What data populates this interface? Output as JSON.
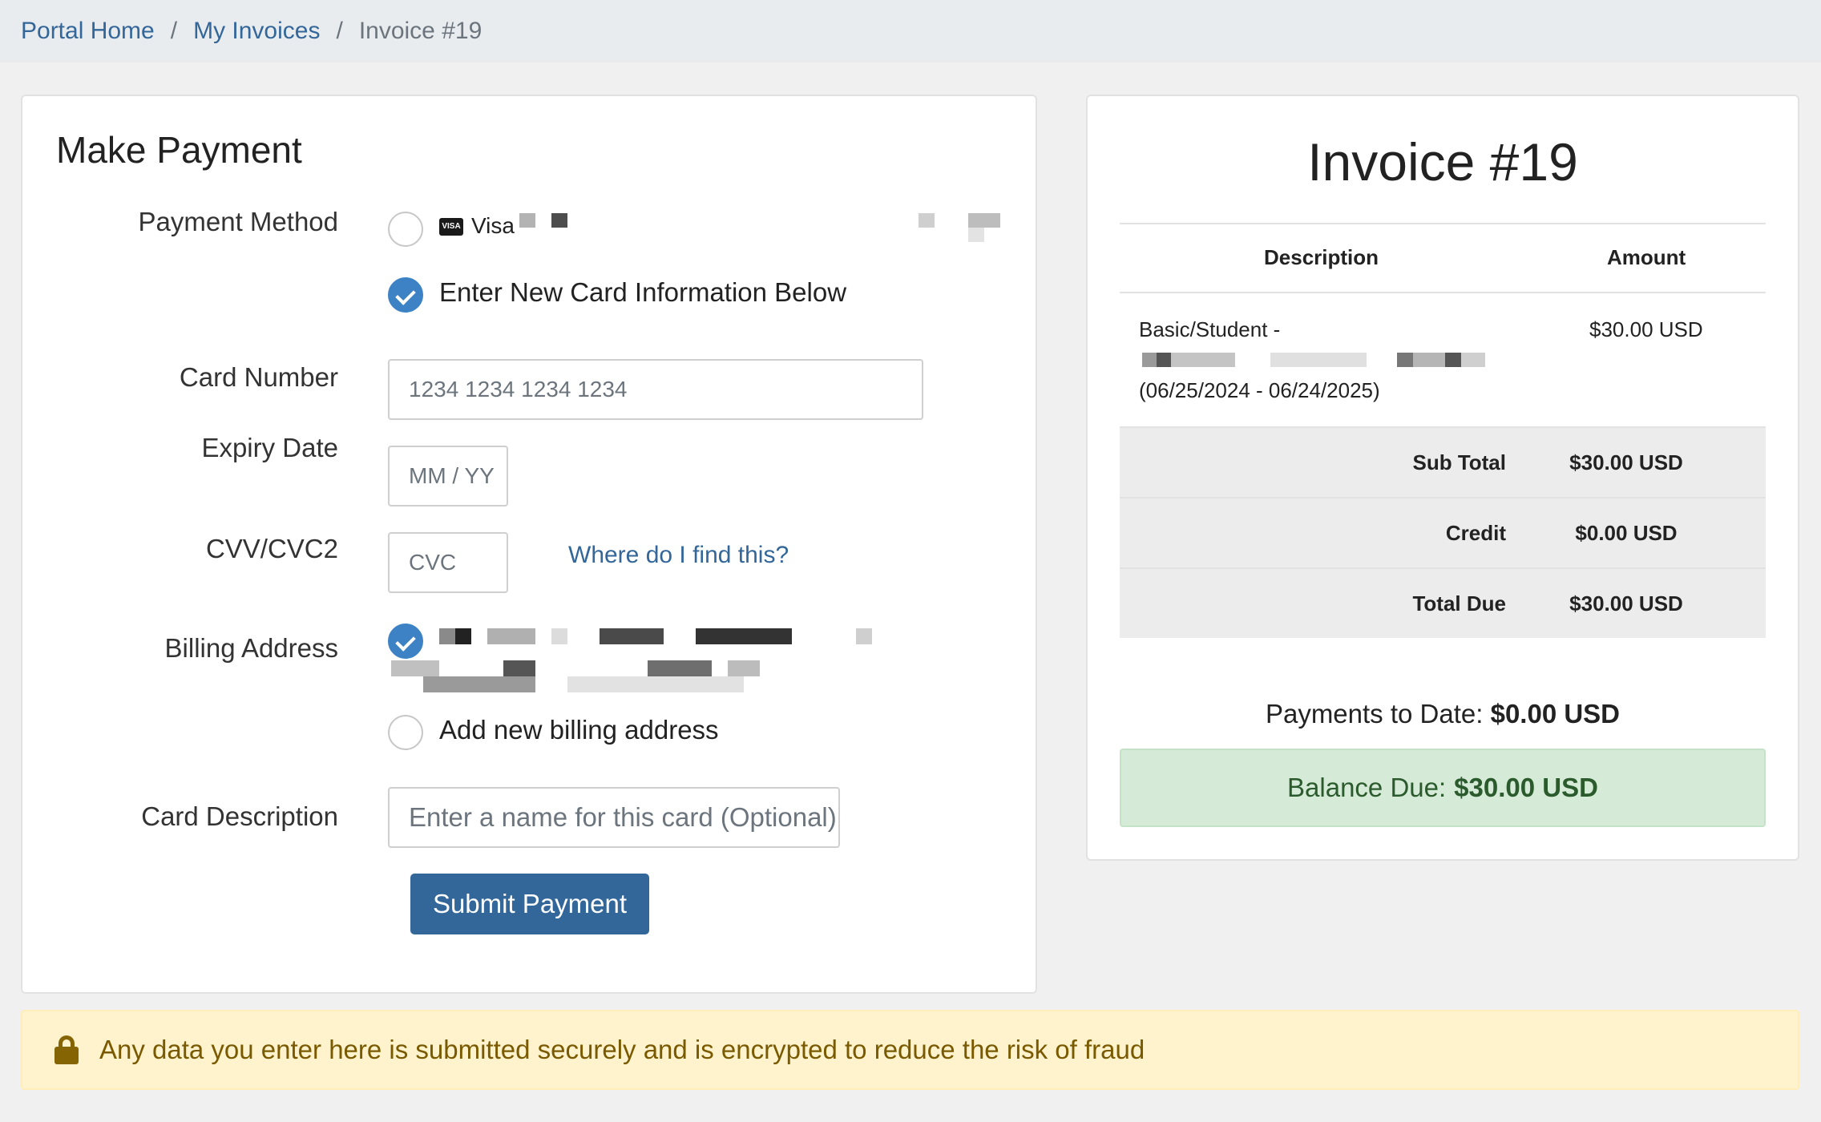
{
  "breadcrumb": {
    "items": [
      "Portal Home",
      "My Invoices"
    ],
    "separator": "/",
    "active": "Invoice #19"
  },
  "payment": {
    "title": "Make Payment",
    "labels": {
      "method": "Payment Method",
      "card_number": "Card Number",
      "expiry": "Expiry Date",
      "cvv": "CVV/CVC2",
      "billing": "Billing Address",
      "card_description": "Card Description"
    },
    "methods": {
      "saved_card_brand": "Visa",
      "new_card": "Enter New Card Information Below",
      "selected": "new_card"
    },
    "card_number_placeholder": "1234 1234 1234 1234",
    "expiry_placeholder": "MM / YY",
    "cvc_placeholder": "CVC",
    "cvc_help_link": "Where do I find this?",
    "billing": {
      "selected": "existing",
      "add_new": "Add new billing address"
    },
    "card_description_placeholder": "Enter a name for this card (Optional)",
    "submit_label": "Submit Payment"
  },
  "invoice": {
    "title": "Invoice #19",
    "columns": [
      "Description",
      "Amount"
    ],
    "items": [
      {
        "desc_line1": "Basic/Student -",
        "desc_line3": "(06/25/2024 - 06/24/2025)",
        "amount": "$30.00 USD"
      }
    ],
    "summary": [
      {
        "label": "Sub Total",
        "value": "$30.00 USD"
      },
      {
        "label": "Credit",
        "value": "$0.00 USD"
      },
      {
        "label": "Total Due",
        "value": "$30.00 USD"
      }
    ],
    "payments_label": "Payments to Date:",
    "payments_value": "$0.00 USD",
    "balance_label": "Balance Due:",
    "balance_value": "$30.00 USD"
  },
  "alert": {
    "text": "Any data you enter here is submitted securely and is encrypted to reduce the risk of fraud"
  },
  "colors": {
    "link": "#336699",
    "primary_button": "#336699",
    "radio_checked": "#3d82c4",
    "balance_bg": "#d5ead7",
    "alert_bg": "#fff3cd"
  }
}
